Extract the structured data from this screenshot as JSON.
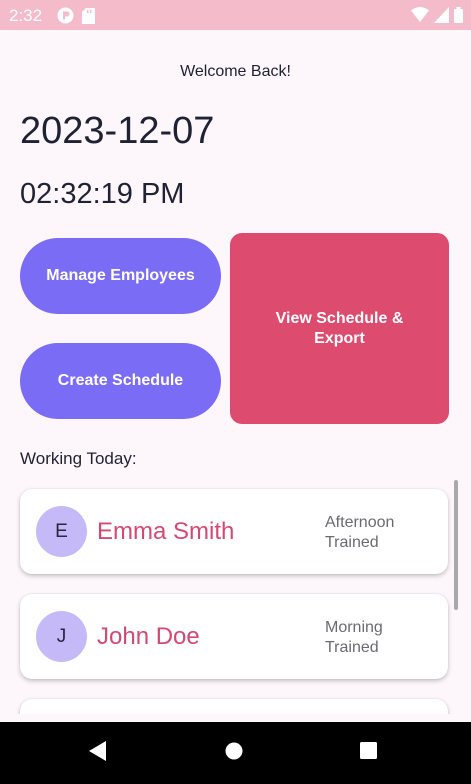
{
  "status_bar": {
    "time": "2:32",
    "background": "#f4bccb"
  },
  "header": {
    "welcome": "Welcome Back!",
    "date": "2023-12-07",
    "time": "02:32:19 PM"
  },
  "actions": {
    "manage_employees": "Manage Employees",
    "create_schedule": "Create Schedule",
    "view_schedule": "View Schedule & Export"
  },
  "working_today": {
    "label": "Working Today:",
    "employees": [
      {
        "initial": "E",
        "name": "Emma Smith",
        "shift": "Afternoon",
        "status": "Trained"
      },
      {
        "initial": "J",
        "name": "John Doe",
        "shift": "Morning",
        "status": "Trained"
      }
    ]
  },
  "colors": {
    "primary_button": "#7b6cf6",
    "accent_button": "#dd4b6e",
    "name_text": "#d24a72",
    "avatar": "#c5baf7"
  },
  "icons": {
    "status_left": [
      "app-notification-icon",
      "sd-card-icon"
    ],
    "status_right": [
      "wifi-icon",
      "signal-icon",
      "battery-icon"
    ],
    "nav": [
      "back-icon",
      "home-icon",
      "recents-icon"
    ]
  }
}
